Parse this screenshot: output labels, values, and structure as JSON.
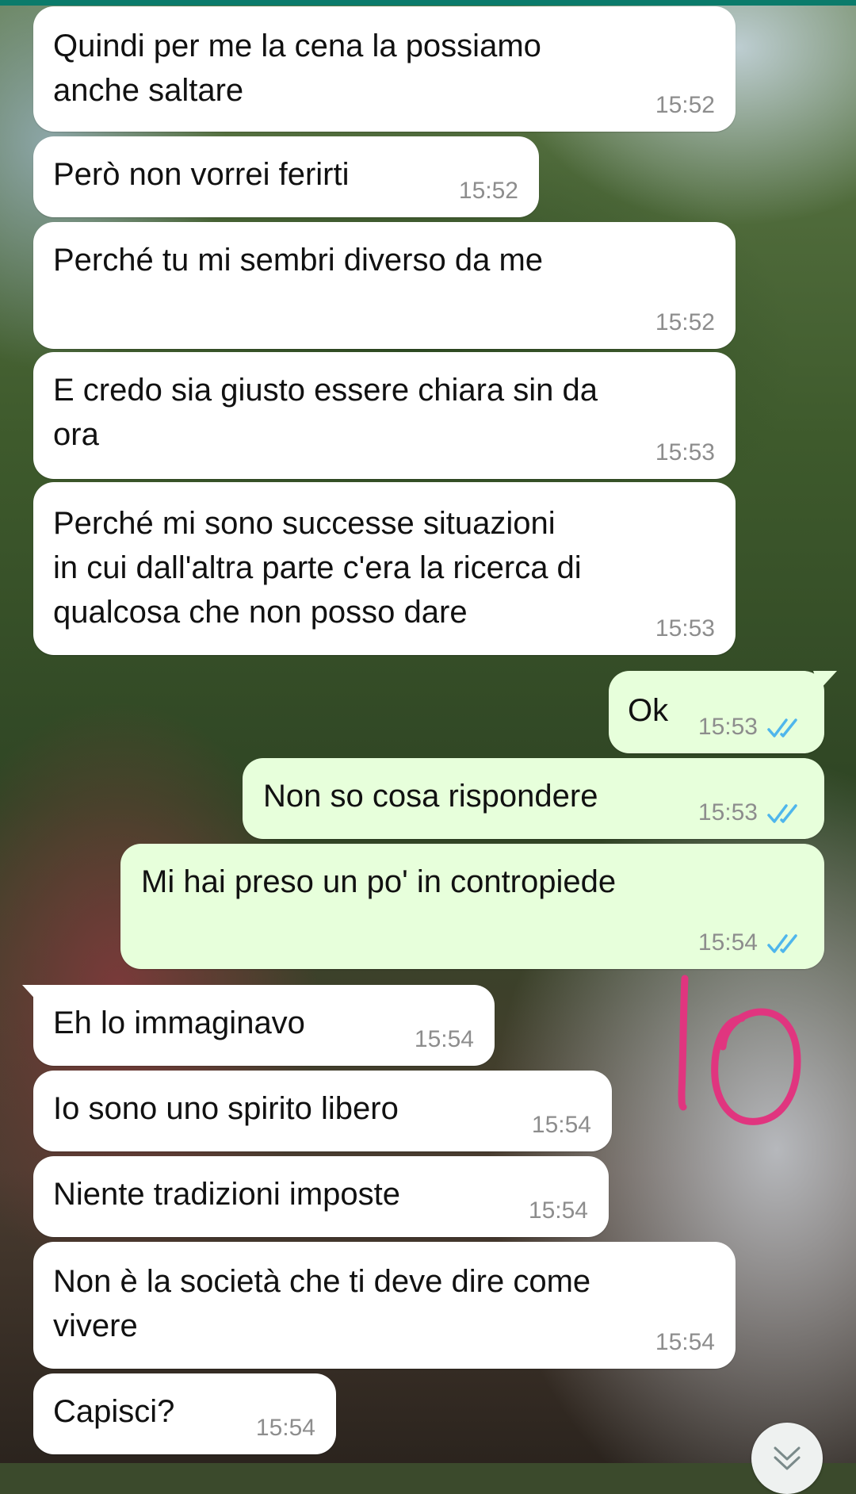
{
  "chat": {
    "messages": [
      {
        "text": "Quindi per me la cena la possiamo\nanche saltare",
        "time": "15:52"
      },
      {
        "text": "Però non vorrei ferirti",
        "time": "15:52"
      },
      {
        "text": "Perché tu mi sembri diverso da me",
        "time": "15:52"
      },
      {
        "text": "E credo sia giusto essere chiara sin da\nora",
        "time": "15:53"
      },
      {
        "text": "Perché mi sono successe situazioni\nin cui dall'altra parte c'era la ricerca di\nqualcosa che non posso dare",
        "time": "15:53"
      },
      {
        "text": "Ok",
        "time": "15:53",
        "status": "read"
      },
      {
        "text": "Non so cosa rispondere",
        "time": "15:53",
        "status": "read"
      },
      {
        "text": "Mi hai preso un po' in contropiede",
        "time": "15:54",
        "status": "read"
      },
      {
        "text": "Eh lo immaginavo",
        "time": "15:54"
      },
      {
        "text": "Io sono uno spirito libero",
        "time": "15:54"
      },
      {
        "text": "Niente tradizioni imposte",
        "time": "15:54"
      },
      {
        "text": "Non è la società che ti deve dire come\nvivere",
        "time": "15:54"
      },
      {
        "text": "Capisci?",
        "time": "15:54"
      }
    ]
  },
  "annotation": {
    "text": "Io",
    "color": "#e0357f"
  },
  "colors": {
    "incoming": "#ffffff",
    "outgoing": "#e7ffdb",
    "read_ticks": "#4fb6ec",
    "header": "#0b7b6b"
  },
  "icons": {
    "read_receipt": "double-check-icon",
    "scroll_down": "chevron-down-icon"
  }
}
